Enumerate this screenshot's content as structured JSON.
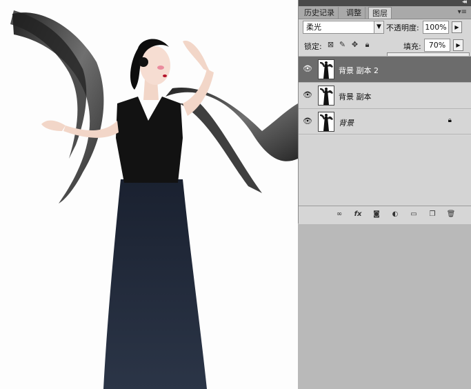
{
  "tabs": [
    {
      "label": "历史记录",
      "active": false
    },
    {
      "label": "调整",
      "active": false
    },
    {
      "label": "图层",
      "active": true
    }
  ],
  "blend_mode": "柔光",
  "opacity_label": "不透明度:",
  "opacity_value": "100%",
  "lock_label": "锁定:",
  "fill_label": "填充:",
  "fill_value": "70%",
  "fill_fraction": 0.7,
  "layers": [
    {
      "name": "背景 副本 2",
      "selected": true,
      "locked": false
    },
    {
      "name": "背景 副本",
      "selected": false,
      "locked": false
    },
    {
      "name": "背景",
      "selected": false,
      "locked": true
    }
  ],
  "icons": {
    "lock": [
      "lock-transparent-icon",
      "lock-paint-icon",
      "lock-move-icon",
      "lock-all-icon"
    ],
    "bottom": [
      "link-icon",
      "fx-icon",
      "mask-icon",
      "adjustment-icon",
      "group-icon",
      "new-layer-icon",
      "trash-icon"
    ]
  },
  "colors": {
    "panel_bg": "#d6d6d6",
    "selected_layer": "#6c6c6c",
    "workspace": "#b9b9b9",
    "slider_thumb": "#4aa0ff"
  }
}
